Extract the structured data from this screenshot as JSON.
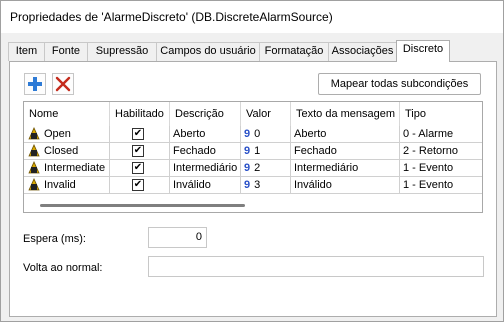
{
  "window": {
    "title": "Propriedades de 'AlarmeDiscreto' (DB.DiscreteAlarmSource)"
  },
  "tabs": [
    "Item",
    "Fonte",
    "Supressão",
    "Campos do usuário",
    "Formatação",
    "Associações",
    "Discreto"
  ],
  "active_tab": "Discreto",
  "toolbar": {
    "add_icon": "plus-icon",
    "remove_icon": "delete-x-icon",
    "map_button": "Mapear todas subcondições"
  },
  "table": {
    "columns": [
      "Nome",
      "Habilitado",
      "Descrição",
      "Valor",
      "Texto da mensagem",
      "Tipo"
    ],
    "rows": [
      {
        "name": "Open",
        "enabled": true,
        "description": "Aberto",
        "value": "0",
        "message": "Aberto",
        "type": "0 - Alarme"
      },
      {
        "name": "Closed",
        "enabled": true,
        "description": "Fechado",
        "value": "1",
        "message": "Fechado",
        "type": "2 - Retorno"
      },
      {
        "name": "Intermediate",
        "enabled": true,
        "description": "Intermediário",
        "value": "2",
        "message": "Intermediário",
        "type": "1 - Evento"
      },
      {
        "name": "Invalid",
        "enabled": true,
        "description": "Inválido",
        "value": "3",
        "message": "Inválido",
        "type": "1 - Evento"
      }
    ],
    "check_glyph": "✔",
    "value_glyph": "9"
  },
  "fields": {
    "espera_label": "Espera (ms):",
    "espera_value": "0",
    "volta_label": "Volta ao normal:",
    "volta_value": ""
  },
  "colors": {
    "accent_blue": "#2e7bd6",
    "delete_red": "#c42b1c",
    "value_icon": "#2b52c8"
  }
}
